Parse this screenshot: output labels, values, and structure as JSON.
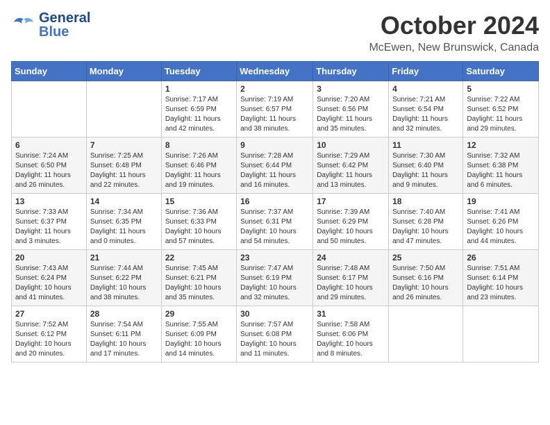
{
  "brand": {
    "name_general": "General",
    "name_blue": "Blue",
    "logo_label": "GeneralBlue"
  },
  "header": {
    "month": "October 2024",
    "location": "McEwen, New Brunswick, Canada"
  },
  "weekdays": [
    "Sunday",
    "Monday",
    "Tuesday",
    "Wednesday",
    "Thursday",
    "Friday",
    "Saturday"
  ],
  "weeks": [
    [
      {
        "day": "",
        "info": ""
      },
      {
        "day": "",
        "info": ""
      },
      {
        "day": "1",
        "info": "Sunrise: 7:17 AM\nSunset: 6:59 PM\nDaylight: 11 hours and 42 minutes."
      },
      {
        "day": "2",
        "info": "Sunrise: 7:19 AM\nSunset: 6:57 PM\nDaylight: 11 hours and 38 minutes."
      },
      {
        "day": "3",
        "info": "Sunrise: 7:20 AM\nSunset: 6:56 PM\nDaylight: 11 hours and 35 minutes."
      },
      {
        "day": "4",
        "info": "Sunrise: 7:21 AM\nSunset: 6:54 PM\nDaylight: 11 hours and 32 minutes."
      },
      {
        "day": "5",
        "info": "Sunrise: 7:22 AM\nSunset: 6:52 PM\nDaylight: 11 hours and 29 minutes."
      }
    ],
    [
      {
        "day": "6",
        "info": "Sunrise: 7:24 AM\nSunset: 6:50 PM\nDaylight: 11 hours and 26 minutes."
      },
      {
        "day": "7",
        "info": "Sunrise: 7:25 AM\nSunset: 6:48 PM\nDaylight: 11 hours and 22 minutes."
      },
      {
        "day": "8",
        "info": "Sunrise: 7:26 AM\nSunset: 6:46 PM\nDaylight: 11 hours and 19 minutes."
      },
      {
        "day": "9",
        "info": "Sunrise: 7:28 AM\nSunset: 6:44 PM\nDaylight: 11 hours and 16 minutes."
      },
      {
        "day": "10",
        "info": "Sunrise: 7:29 AM\nSunset: 6:42 PM\nDaylight: 11 hours and 13 minutes."
      },
      {
        "day": "11",
        "info": "Sunrise: 7:30 AM\nSunset: 6:40 PM\nDaylight: 11 hours and 9 minutes."
      },
      {
        "day": "12",
        "info": "Sunrise: 7:32 AM\nSunset: 6:38 PM\nDaylight: 11 hours and 6 minutes."
      }
    ],
    [
      {
        "day": "13",
        "info": "Sunrise: 7:33 AM\nSunset: 6:37 PM\nDaylight: 11 hours and 3 minutes."
      },
      {
        "day": "14",
        "info": "Sunrise: 7:34 AM\nSunset: 6:35 PM\nDaylight: 11 hours and 0 minutes."
      },
      {
        "day": "15",
        "info": "Sunrise: 7:36 AM\nSunset: 6:33 PM\nDaylight: 10 hours and 57 minutes."
      },
      {
        "day": "16",
        "info": "Sunrise: 7:37 AM\nSunset: 6:31 PM\nDaylight: 10 hours and 54 minutes."
      },
      {
        "day": "17",
        "info": "Sunrise: 7:39 AM\nSunset: 6:29 PM\nDaylight: 10 hours and 50 minutes."
      },
      {
        "day": "18",
        "info": "Sunrise: 7:40 AM\nSunset: 6:28 PM\nDaylight: 10 hours and 47 minutes."
      },
      {
        "day": "19",
        "info": "Sunrise: 7:41 AM\nSunset: 6:26 PM\nDaylight: 10 hours and 44 minutes."
      }
    ],
    [
      {
        "day": "20",
        "info": "Sunrise: 7:43 AM\nSunset: 6:24 PM\nDaylight: 10 hours and 41 minutes."
      },
      {
        "day": "21",
        "info": "Sunrise: 7:44 AM\nSunset: 6:22 PM\nDaylight: 10 hours and 38 minutes."
      },
      {
        "day": "22",
        "info": "Sunrise: 7:45 AM\nSunset: 6:21 PM\nDaylight: 10 hours and 35 minutes."
      },
      {
        "day": "23",
        "info": "Sunrise: 7:47 AM\nSunset: 6:19 PM\nDaylight: 10 hours and 32 minutes."
      },
      {
        "day": "24",
        "info": "Sunrise: 7:48 AM\nSunset: 6:17 PM\nDaylight: 10 hours and 29 minutes."
      },
      {
        "day": "25",
        "info": "Sunrise: 7:50 AM\nSunset: 6:16 PM\nDaylight: 10 hours and 26 minutes."
      },
      {
        "day": "26",
        "info": "Sunrise: 7:51 AM\nSunset: 6:14 PM\nDaylight: 10 hours and 23 minutes."
      }
    ],
    [
      {
        "day": "27",
        "info": "Sunrise: 7:52 AM\nSunset: 6:12 PM\nDaylight: 10 hours and 20 minutes."
      },
      {
        "day": "28",
        "info": "Sunrise: 7:54 AM\nSunset: 6:11 PM\nDaylight: 10 hours and 17 minutes."
      },
      {
        "day": "29",
        "info": "Sunrise: 7:55 AM\nSunset: 6:09 PM\nDaylight: 10 hours and 14 minutes."
      },
      {
        "day": "30",
        "info": "Sunrise: 7:57 AM\nSunset: 6:08 PM\nDaylight: 10 hours and 11 minutes."
      },
      {
        "day": "31",
        "info": "Sunrise: 7:58 AM\nSunset: 6:06 PM\nDaylight: 10 hours and 8 minutes."
      },
      {
        "day": "",
        "info": ""
      },
      {
        "day": "",
        "info": ""
      }
    ]
  ]
}
